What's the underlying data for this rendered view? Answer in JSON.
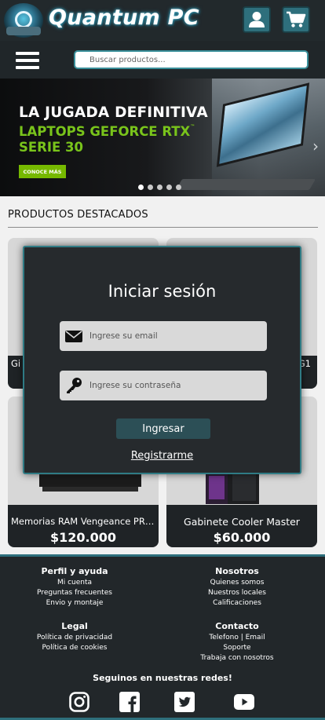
{
  "header": {
    "brand": "Quantum PC",
    "icons": {
      "logo": "globe-logo",
      "user": "user-icon",
      "cart": "cart-icon"
    },
    "colors": {
      "bar": "#22292c",
      "accent": "#2e6f7c"
    }
  },
  "navbar": {
    "menu_icon": "hamburger-icon",
    "search_placeholder": "Buscar productos..."
  },
  "banner": {
    "headline": "LA JUGADA DEFINITIVA",
    "subline1": "LAPTOPS GEFORCE RTX",
    "trademark": "™",
    "subline2": "SERIE 30",
    "cta": "CONOCE MÁS",
    "slides": 5,
    "active_slide": 1,
    "colors": {
      "green": "#76b900"
    }
  },
  "products": {
    "title": "PRODUCTOS DESTACADOS",
    "items": [
      {
        "name": "Gi",
        "price": ""
      },
      {
        "name": "G1",
        "price": ""
      },
      {
        "name": "Memorias RAM Vengeance PRO...",
        "price": "$120.000"
      },
      {
        "name": "Gabinete Cooler Master",
        "price": "$60.000"
      }
    ]
  },
  "login": {
    "title": "Iniciar sesión",
    "email_placeholder": "Ingrese su email",
    "password_placeholder": "Ingrese su contraseña",
    "submit": "Ingresar",
    "register": "Registrarme",
    "icons": {
      "email": "envelope-icon",
      "password": "key-icon"
    }
  },
  "footer": {
    "profile": {
      "title": "Perfil y ayuda",
      "links": [
        "Mi cuenta",
        "Preguntas frecuentes",
        "Envio y montaje"
      ]
    },
    "about": {
      "title": "Nosotros",
      "links": [
        "Quienes somos",
        "Nuestros locales",
        "Calificaciones"
      ]
    },
    "legal": {
      "title": "Legal",
      "links": [
        "Política de privacidad",
        "Política de cookies"
      ]
    },
    "contact": {
      "title": "Contacto",
      "links": [
        "Telefono | Email",
        "Soporte",
        "Trabaja con nosotros"
      ]
    },
    "social_title": "Seguinos en nuestras redes!",
    "social_icons": [
      "instagram-icon",
      "facebook-icon",
      "twitter-icon",
      "youtube-icon"
    ]
  }
}
